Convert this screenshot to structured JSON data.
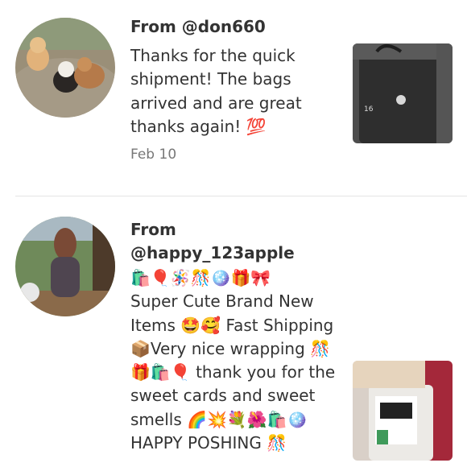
{
  "reviews": [
    {
      "from": "From @don660",
      "body": "Thanks for the quick shipment! The bags arrived and are great thanks again! 💯",
      "date": "Feb 10",
      "avatar_icon": "dogs-photo-avatar",
      "thumb_icon": "black-bag-photo",
      "thumb_label": "16"
    },
    {
      "from": "From @happy_123apple",
      "emoji_line": "🛍️🎈🪅🎊🪩🎁🎀",
      "body": "Super Cute Brand New Items 🤩🥰 Fast Shipping 📦Very nice wrapping 🎊🎁🛍️🎈 thank you for the sweet cards and sweet smells 🌈💥💐🌺🛍️🪩",
      "cut_line": "HAPPY POSHING 🎊",
      "avatar_icon": "woman-photo-avatar",
      "thumb_icon": "product-package-photo"
    }
  ]
}
